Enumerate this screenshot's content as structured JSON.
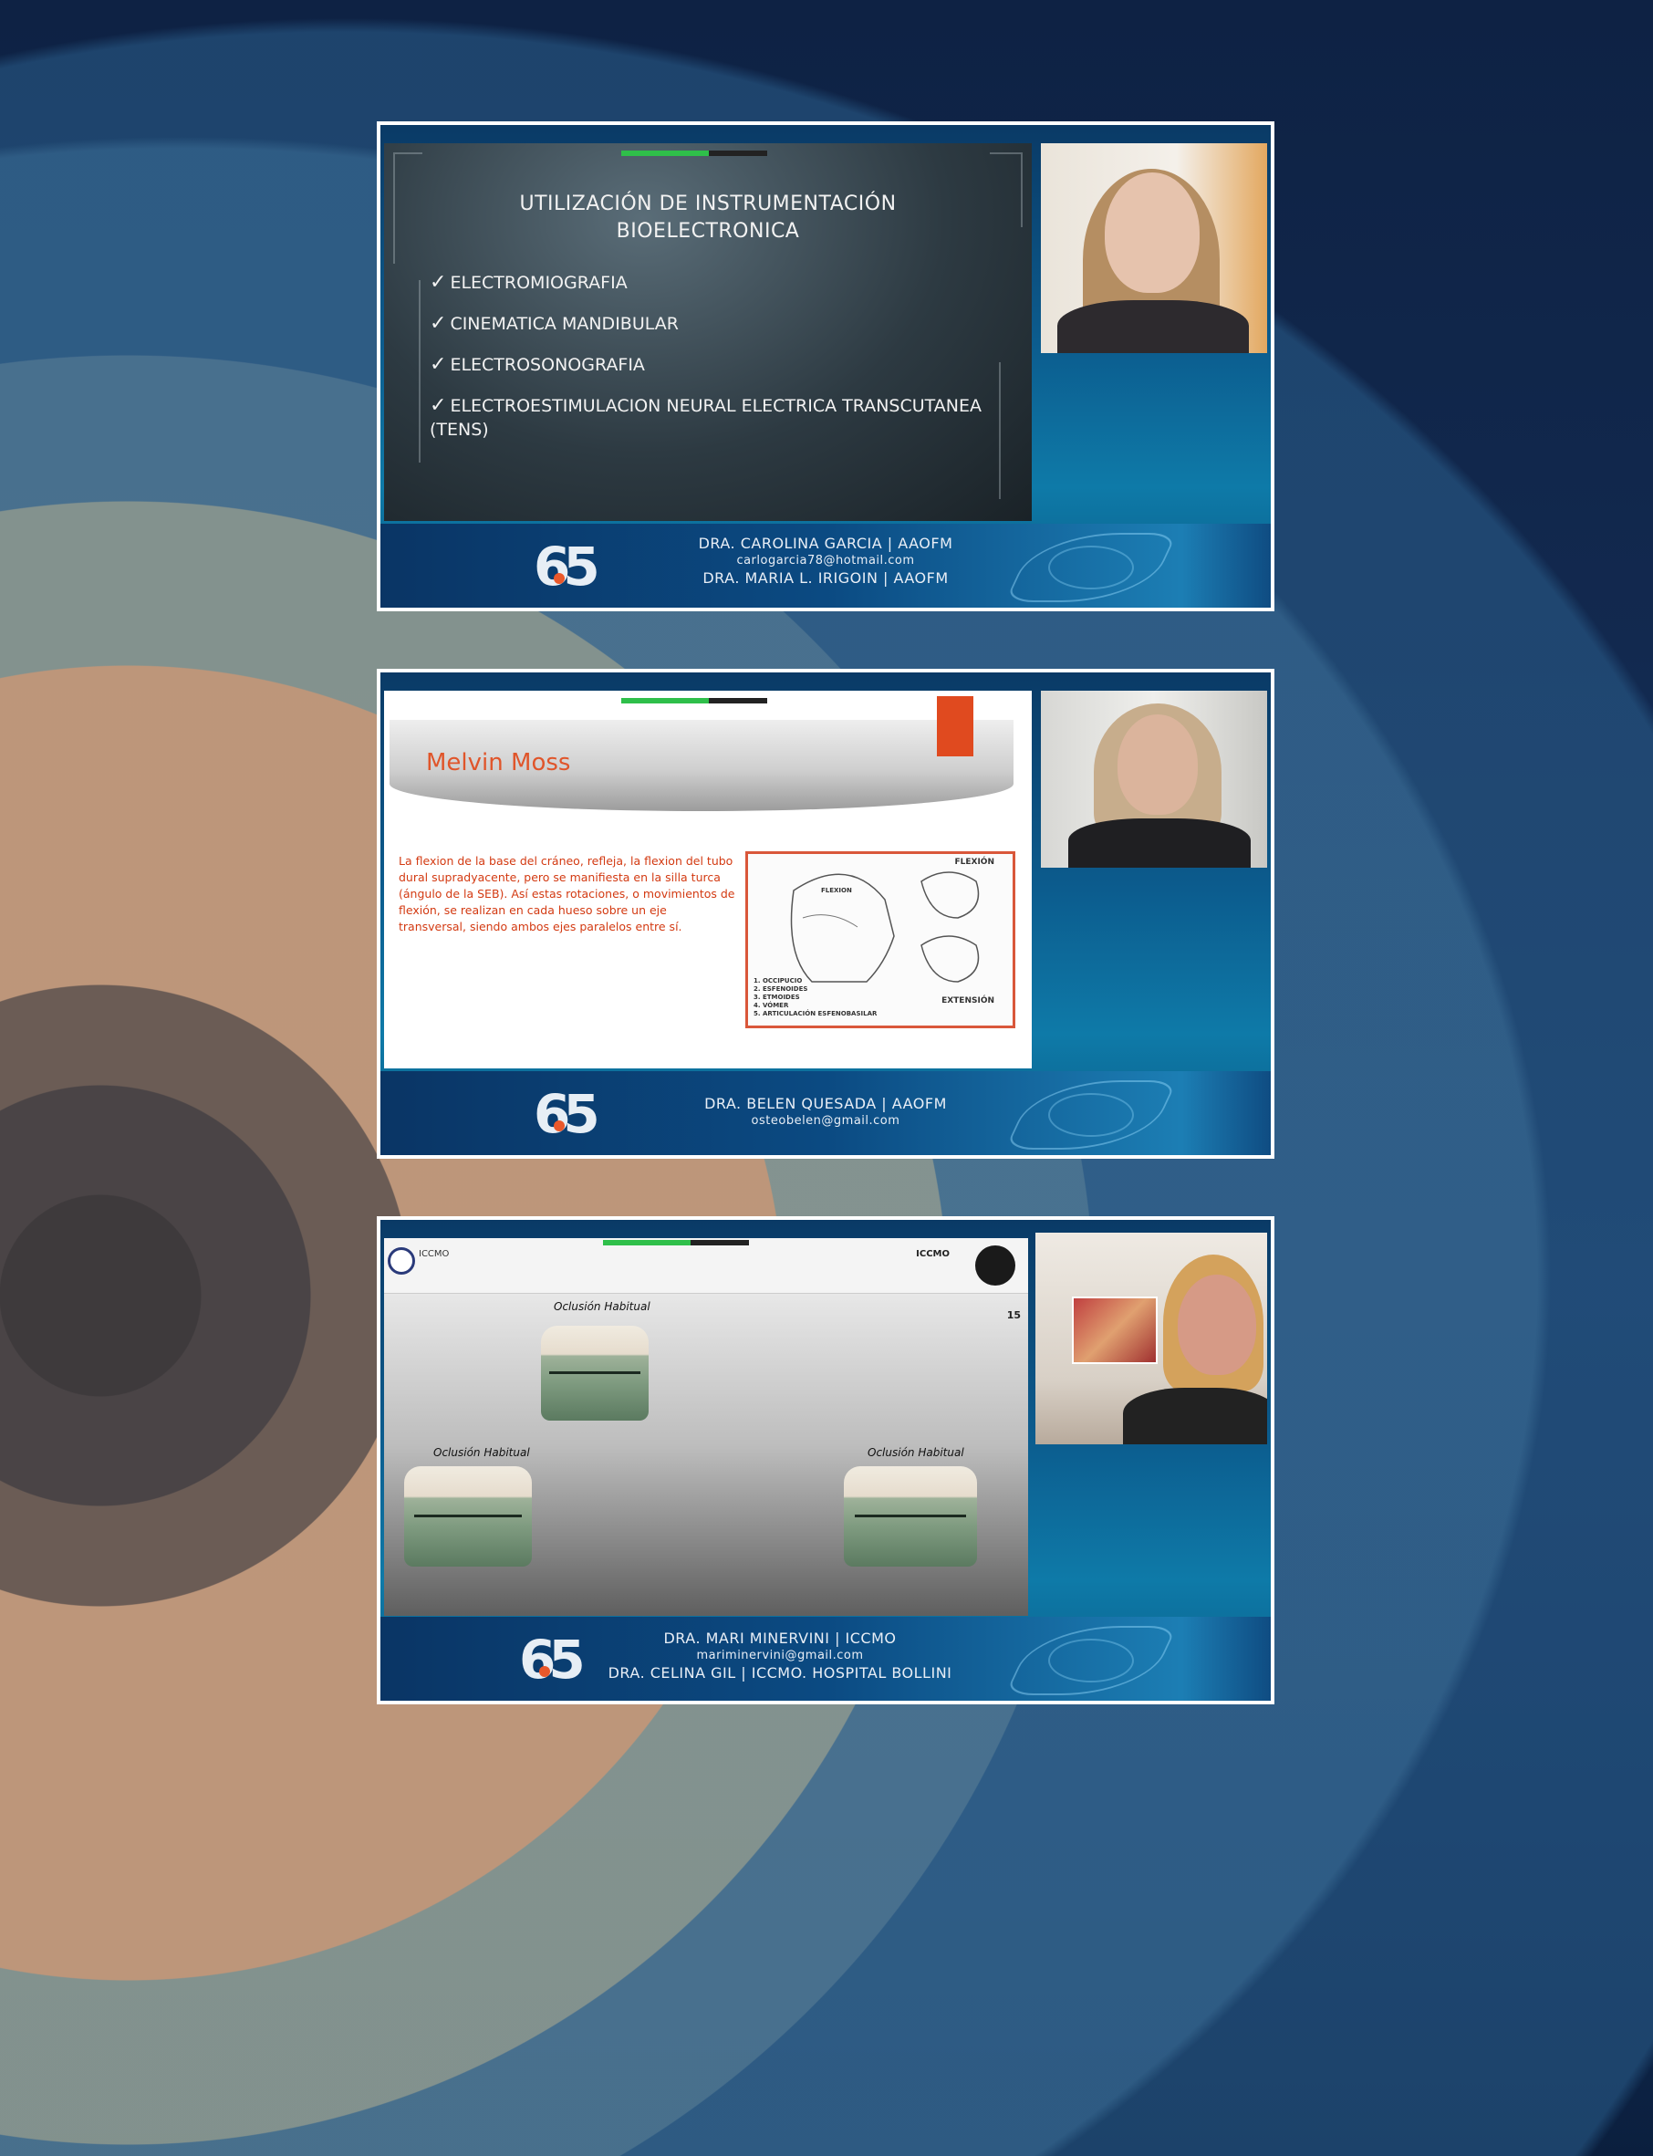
{
  "panels": [
    {
      "slide_title_line1": "UTILIZACIÓN DE INSTRUMENTACIÓN",
      "slide_title_line2": "BIOELECTRONICA",
      "bullets": [
        "ELECTROMIOGRAFIA",
        "CINEMATICA MANDIBULAR",
        "ELECTROSONOGRAFIA",
        "ELECTROESTIMULACION NEURAL ELECTRICA TRANSCUTANEA (TENS)"
      ],
      "check": "✓",
      "footer_line1": "DRA. CAROLINA GARCIA | AAOFM",
      "footer_line2": "carlogarcia78@hotmail.com",
      "footer_line3": "DRA. MARIA L. IRIGOIN | AAOFM"
    },
    {
      "slide_title": "Melvin Moss",
      "body": "La flexion de la base del cráneo, refleja, la flexion del tubo dural supradyacente, pero se manifiesta en la silla turca (ángulo de la SEB). Así estas rotaciones, o movimientos de flexión, se realizan en cada hueso sobre un eje transversal, siendo ambos ejes paralelos entre sí.",
      "figure_label_flexion": "FLEXIÓN",
      "figure_label_flexion_small": "FLEXION",
      "figure_label_extension": "EXTENSIÓN",
      "figure_legend": [
        "1. OCCIPUCIO",
        "2. ESFENOIDES",
        "3. ETMOIDES",
        "4. VÓMER",
        "5. ARTICULACIÓN ESFENOBASILAR"
      ],
      "footer_line1": "DRA. BELEN QUESADA | AAOFM",
      "footer_line2": "osteobelen@gmail.com"
    },
    {
      "header_left": "ICCMO",
      "header_right": "ICCMO",
      "page_number": "15",
      "caption_top": "Oclusión Habitual",
      "caption_left": "Oclusión Habitual",
      "caption_right": "Oclusión Habitual",
      "footer_line1": "DRA. MARI MINERVINI | ICCMO",
      "footer_line2": "mariminervini@gmail.com",
      "footer_line3": "DRA. CELINA GIL | ICCMO. HOSPITAL BOLLINI"
    }
  ],
  "logo_text": "65",
  "colors": {
    "accent_orange": "#e04a1f",
    "progress_green": "#2fbf4a",
    "frame_border": "#ffffff"
  },
  "icons": [
    "anniversary-65-logo",
    "iccmo-logo",
    "checkmark-icon"
  ]
}
